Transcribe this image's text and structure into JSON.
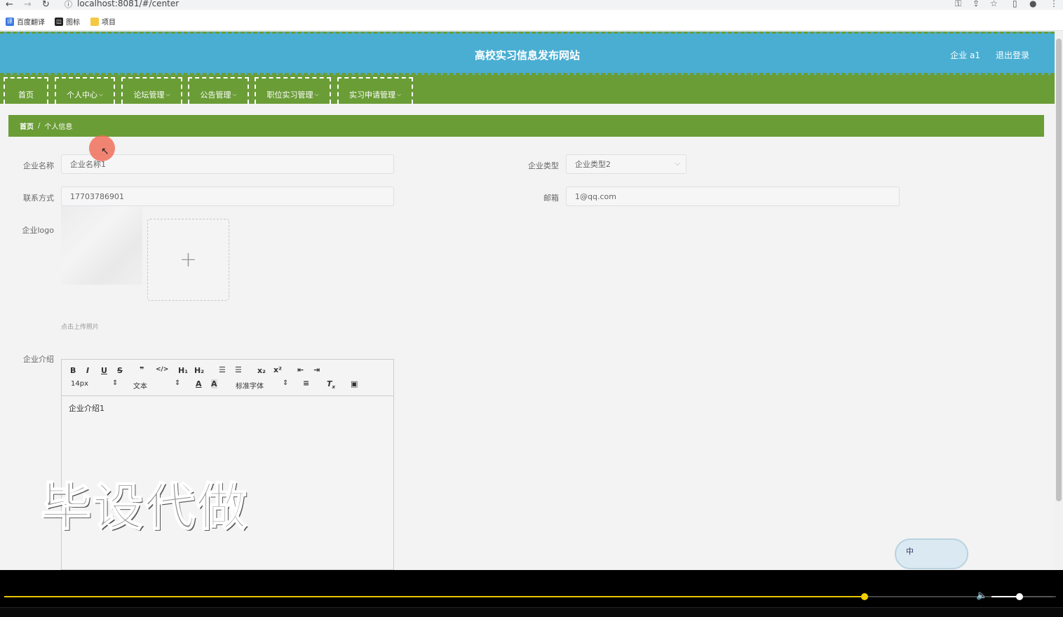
{
  "browser": {
    "url": "localhost:8081/#/center",
    "bookmarks": [
      "百度翻译",
      "图标",
      "项目"
    ]
  },
  "header": {
    "site_title": "高校实习信息发布网站",
    "user_label": "企业 a1",
    "logout_label": "退出登录"
  },
  "nav": {
    "items": [
      "首页",
      "个人中心",
      "论坛管理",
      "公告管理",
      "职位实习管理",
      "实习申请管理"
    ]
  },
  "breadcrumb": {
    "home": "首页",
    "separator": "/",
    "current": "个人信息"
  },
  "form": {
    "company_name": {
      "label": "企业名称",
      "value": "企业名称1"
    },
    "company_type": {
      "label": "企业类型",
      "value": "企业类型2"
    },
    "contact": {
      "label": "联系方式",
      "value": "17703786901"
    },
    "email": {
      "label": "邮箱",
      "value": "1@qq.com"
    },
    "logo": {
      "label": "企业logo",
      "tip": "点击上传照片"
    },
    "intro": {
      "label": "企业介绍",
      "content": "企业介绍1",
      "toolbar": {
        "font_size": "14px",
        "header": "文本",
        "font_family": "标准字体"
      }
    }
  },
  "overlay": {
    "watermark": "毕设代做",
    "ime_label": "中"
  },
  "player": {
    "progress": 0.818,
    "volume": 0.45
  }
}
